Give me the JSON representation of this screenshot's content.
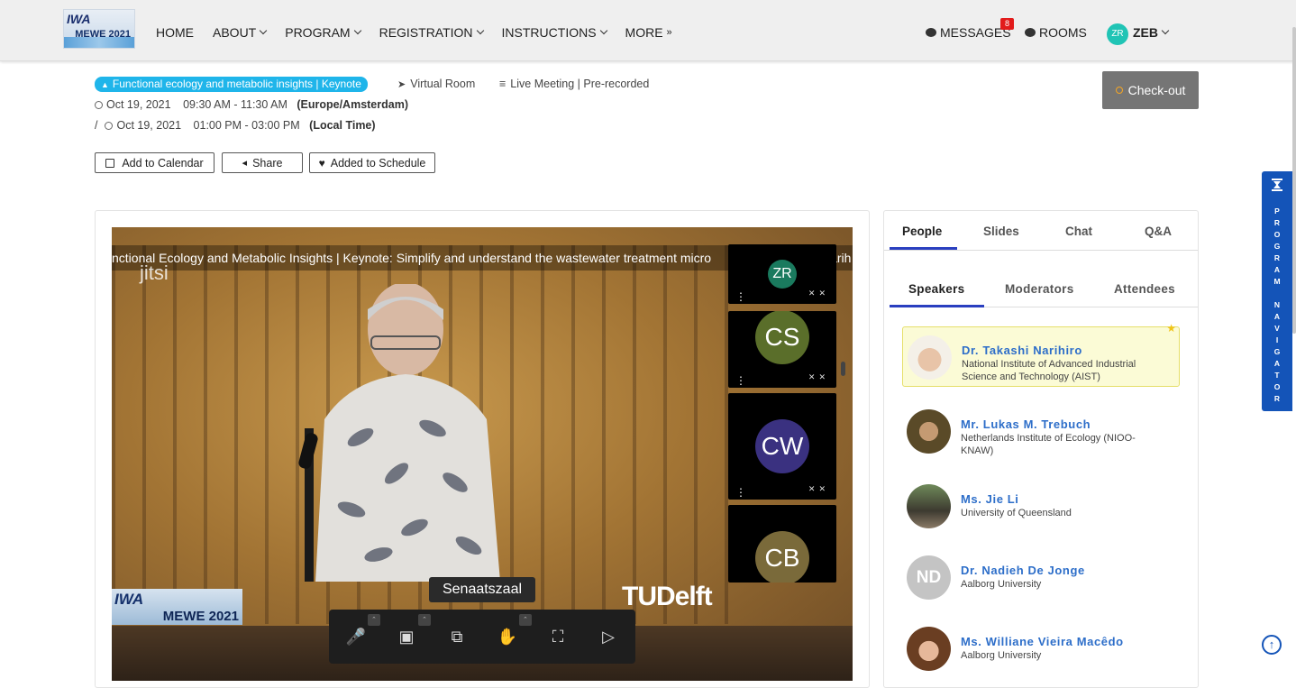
{
  "header": {
    "logo_text_top": "IWA",
    "logo_text_bottom": "MEWE 2021",
    "nav": [
      "HOME",
      "ABOUT",
      "PROGRAM",
      "REGISTRATION",
      "INSTRUCTIONS",
      "MORE"
    ],
    "messages_label": "MESSAGES",
    "messages_count": "8",
    "rooms_label": "ROOMS",
    "user_initials": "ZR",
    "user_label": "ZEB"
  },
  "session": {
    "track_label": "Functional ecology and metabolic insights | Keynote",
    "room_label": "Virtual Room",
    "format_label": "Live Meeting | Pre-recorded",
    "date1": "Oct 19, 2021",
    "time1": "09:30 AM - 11:30 AM",
    "tz1": "(Europe/Amsterdam)",
    "sep": "/",
    "date2": "Oct 19, 2021",
    "time2": "01:00 PM - 03:00 PM",
    "tz2": "(Local Time)",
    "checkout_label": "Check-out",
    "add_calendar_label": "Add to Calendar",
    "share_label": "Share",
    "schedule_label": "Added to Schedule"
  },
  "video": {
    "ticker": "nctional Ecology and Metabolic Insights | Keynote: Simplify and understand the wastewater treatment micro",
    "ticker_tail": "arih",
    "watermark": "jitsi",
    "room_name": "Senaatszaal",
    "sponsor_text": "TUDelft",
    "logo_top": "IWA",
    "logo_bottom": "MEWE 2021",
    "participants": [
      {
        "initials": "ZR",
        "color": "#1a7a5e"
      },
      {
        "initials": "CS",
        "color": "#5a6e2a"
      },
      {
        "initials": "CW",
        "color": "#3a3180"
      },
      {
        "initials": "CB",
        "color": "#7a6a3a"
      }
    ]
  },
  "panel": {
    "tabs": [
      "People",
      "Slides",
      "Chat",
      "Q&A"
    ],
    "active_tab": "People",
    "subtabs": [
      "Speakers",
      "Moderators",
      "Attendees"
    ],
    "active_subtab": "Speakers",
    "speakers": [
      {
        "name": "Dr. Takashi Narihiro",
        "org": "National Institute of Advanced Industrial Science and Technology (AIST)",
        "highlight": true,
        "initials": ""
      },
      {
        "name": "Mr. Lukas M. Trebuch",
        "org": "Netherlands Institute of Ecology (NIOO-KNAW)",
        "highlight": false,
        "initials": ""
      },
      {
        "name": "Ms. Jie Li",
        "org": "University of Queensland",
        "highlight": false,
        "initials": ""
      },
      {
        "name": "Dr. Nadieh De Jonge",
        "org": "Aalborg University",
        "highlight": false,
        "initials": "ND"
      },
      {
        "name": "Ms. Williane Vieira Macêdo",
        "org": "Aalborg University",
        "highlight": false,
        "initials": ""
      }
    ]
  },
  "program_navigator": {
    "letters": [
      "P",
      "R",
      "O",
      "G",
      "R",
      "A",
      "M",
      "",
      "N",
      "A",
      "V",
      "I",
      "G",
      "A",
      "T",
      "O",
      "R"
    ]
  },
  "colors": {
    "accent_blue": "#1454b8",
    "pill_blue": "#1fb5ea",
    "link_blue": "#2d6ec9",
    "badge_red": "#e21b1b"
  }
}
